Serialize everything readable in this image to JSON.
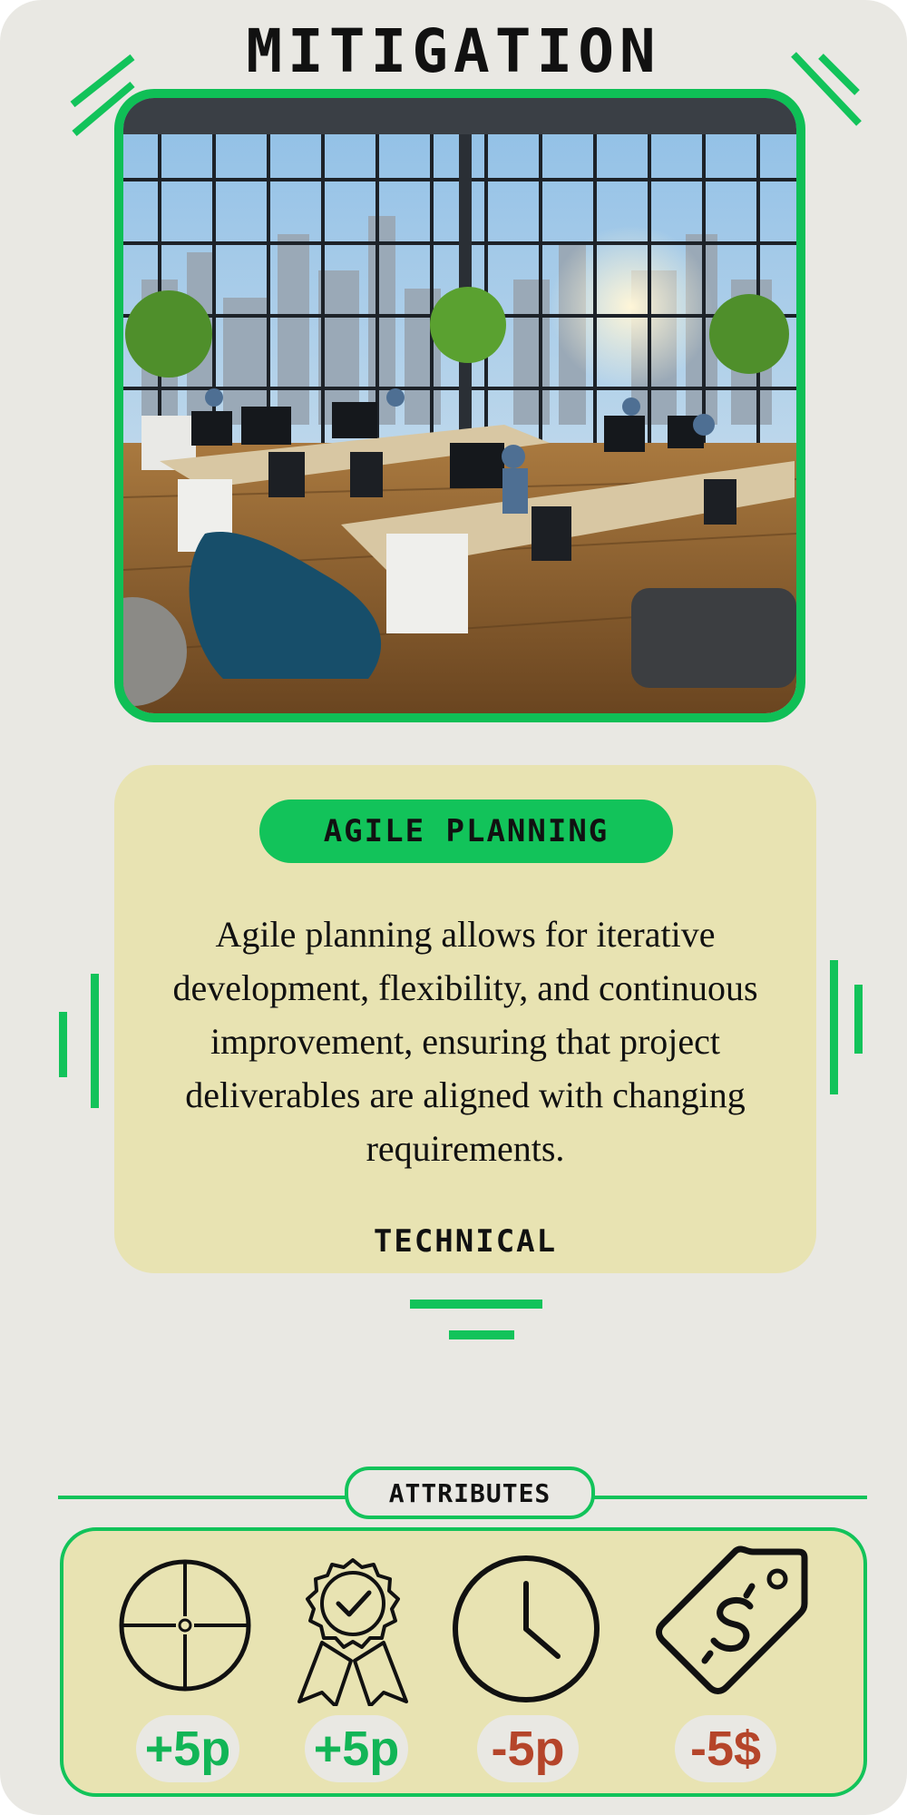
{
  "card": {
    "type_label": "MITIGATION",
    "name": "AGILE PLANNING",
    "description": "Agile planning allows for iterative development, flexibility, and continuous improvement, ensuring that project deliverables are aligned with changing requirements.",
    "category": "TECHNICAL"
  },
  "attributes": {
    "section_label": "ATTRIBUTES",
    "items": [
      {
        "icon": "crosshair-icon",
        "value": "+5p",
        "color": "#12b556"
      },
      {
        "icon": "award-ribbon-icon",
        "value": "+5p",
        "color": "#12b556"
      },
      {
        "icon": "clock-icon",
        "value": "-5p",
        "color": "#b5452a"
      },
      {
        "icon": "price-tag-dollar-icon",
        "value": "-5$",
        "color": "#b5452a"
      }
    ]
  },
  "colors": {
    "accent": "#12c35a",
    "panel": "#e8e3b2",
    "background": "#e9e8e3",
    "positive": "#12b556",
    "negative": "#b5452a"
  }
}
